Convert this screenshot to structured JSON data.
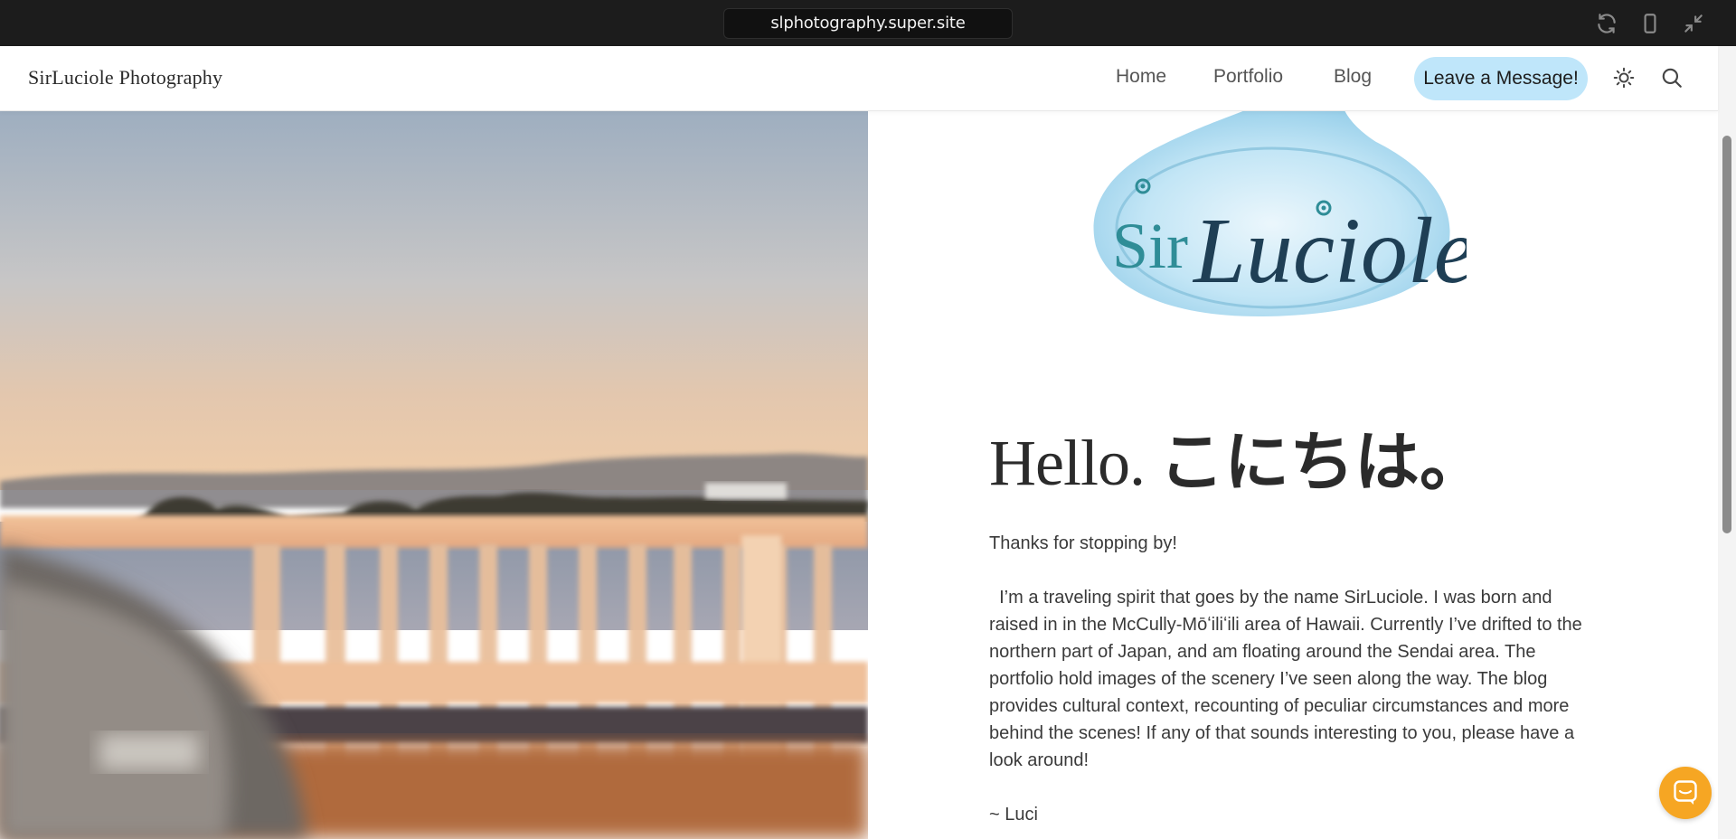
{
  "browser": {
    "url": "slphotography.super.site",
    "icons": [
      "refresh-icon",
      "mobile-view-icon",
      "collapse-icon"
    ]
  },
  "header": {
    "brand": "SirLuciole Photography",
    "nav": [
      {
        "label": "Home"
      },
      {
        "label": "Portfolio"
      },
      {
        "label": "Blog"
      }
    ],
    "cta_label": "Leave a Message!",
    "icons": [
      "theme-toggle-icon",
      "search-icon"
    ]
  },
  "hero": {
    "description_icon": "photo-bridge-sunset-with-blurred-car"
  },
  "main": {
    "logo": {
      "text_sir": "Sir",
      "text_luciole": "Luciole"
    },
    "heading_en": "Hello.",
    "heading_jp": "こにちは。",
    "intro": "Thanks for stopping by!",
    "body": "  I’m a traveling spirit that goes by the name SirLuciole. I was born and raised in in the McCully-Mōʻiliʻili area of Hawaii. Currently I’ve drifted to the northern part of Japan, and am floating around the Sendai area. The portfolio hold images of the scenery I’ve seen along the way. The blog provides cultural context, recounting of peculiar circumstances and more behind the scenes! If any of that sounds interesting to you, please have a look around!",
    "signature": "~ Luci"
  },
  "chat": {
    "icon": "chat-icon"
  },
  "colors": {
    "topbar": "#1c1c1c",
    "cta_bg": "#bfe6fa",
    "chat_bg": "#f6a623",
    "logo_teal": "#2f8d97",
    "logo_navy": "#1f3f55"
  }
}
